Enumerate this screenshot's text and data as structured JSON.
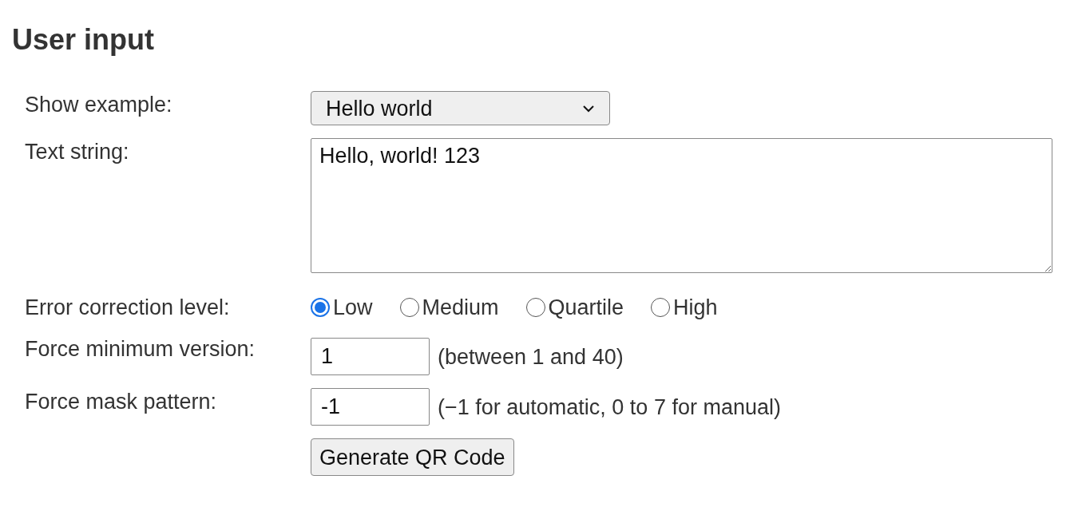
{
  "heading": "User input",
  "example": {
    "label": "Show example:",
    "value": "Hello world"
  },
  "text_string": {
    "label": "Text string:",
    "value": "Hello, world! 123"
  },
  "error_correction": {
    "label": "Error correction level:",
    "options": [
      {
        "label": "Low",
        "selected": true
      },
      {
        "label": "Medium",
        "selected": false
      },
      {
        "label": "Quartile",
        "selected": false
      },
      {
        "label": "High",
        "selected": false
      }
    ]
  },
  "min_version": {
    "label": "Force minimum version:",
    "value": "1",
    "hint": "(between 1 and 40)"
  },
  "mask": {
    "label": "Force mask pattern:",
    "value": "-1",
    "hint": "(−1 for automatic, 0 to 7 for manual)"
  },
  "button": "Generate QR Code"
}
